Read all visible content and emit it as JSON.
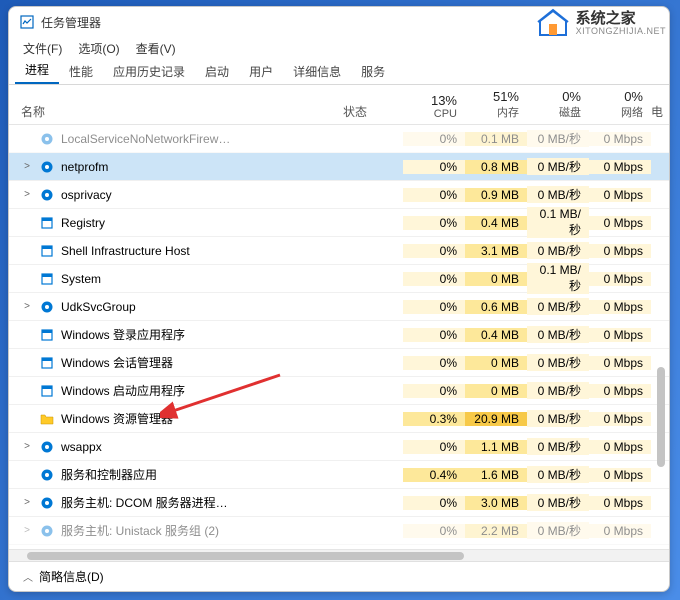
{
  "window": {
    "title": "任务管理器"
  },
  "menu": {
    "file": "文件(F)",
    "options": "选项(O)",
    "view": "查看(V)"
  },
  "tabs": [
    "进程",
    "性能",
    "应用历史记录",
    "启动",
    "用户",
    "详细信息",
    "服务"
  ],
  "activeTab": 0,
  "headers": {
    "name": "名称",
    "status": "状态",
    "cpu_pct": "13%",
    "cpu_lbl": "CPU",
    "mem_pct": "51%",
    "mem_lbl": "内存",
    "disk_pct": "0%",
    "disk_lbl": "磁盘",
    "net_pct": "0%",
    "net_lbl": "网络",
    "power": "电"
  },
  "rows": [
    {
      "icon": "gear",
      "name": "LocalServiceNoNetworkFirew…",
      "cpu": "0%",
      "mem": "0.1 MB",
      "disk": "0 MB/秒",
      "net": "0 Mbps",
      "expand": "",
      "faded": true
    },
    {
      "icon": "gear",
      "name": "netprofm",
      "cpu": "0%",
      "mem": "0.8 MB",
      "disk": "0 MB/秒",
      "net": "0 Mbps",
      "expand": ">",
      "selected": true
    },
    {
      "icon": "gear",
      "name": "osprivacy",
      "cpu": "0%",
      "mem": "0.9 MB",
      "disk": "0 MB/秒",
      "net": "0 Mbps",
      "expand": ">"
    },
    {
      "icon": "app",
      "name": "Registry",
      "cpu": "0%",
      "mem": "0.4 MB",
      "disk": "0.1 MB/秒",
      "net": "0 Mbps",
      "expand": ""
    },
    {
      "icon": "app",
      "name": "Shell Infrastructure Host",
      "cpu": "0%",
      "mem": "3.1 MB",
      "disk": "0 MB/秒",
      "net": "0 Mbps",
      "expand": ""
    },
    {
      "icon": "app",
      "name": "System",
      "cpu": "0%",
      "mem": "0 MB",
      "disk": "0.1 MB/秒",
      "net": "0 Mbps",
      "expand": ""
    },
    {
      "icon": "gear",
      "name": "UdkSvcGroup",
      "cpu": "0%",
      "mem": "0.6 MB",
      "disk": "0 MB/秒",
      "net": "0 Mbps",
      "expand": ">"
    },
    {
      "icon": "app",
      "name": "Windows 登录应用程序",
      "cpu": "0%",
      "mem": "0.4 MB",
      "disk": "0 MB/秒",
      "net": "0 Mbps",
      "expand": ""
    },
    {
      "icon": "app",
      "name": "Windows 会话管理器",
      "cpu": "0%",
      "mem": "0 MB",
      "disk": "0 MB/秒",
      "net": "0 Mbps",
      "expand": ""
    },
    {
      "icon": "app",
      "name": "Windows 启动应用程序",
      "cpu": "0%",
      "mem": "0 MB",
      "disk": "0 MB/秒",
      "net": "0 Mbps",
      "expand": ""
    },
    {
      "icon": "folder",
      "name": "Windows 资源管理器",
      "cpu": "0.3%",
      "mem": "20.9 MB",
      "disk": "0 MB/秒",
      "net": "0 Mbps",
      "expand": "",
      "cpuHigh": true,
      "memHigh": true
    },
    {
      "icon": "gear",
      "name": "wsappx",
      "cpu": "0%",
      "mem": "1.1 MB",
      "disk": "0 MB/秒",
      "net": "0 Mbps",
      "expand": ">"
    },
    {
      "icon": "gear",
      "name": "服务和控制器应用",
      "cpu": "0.4%",
      "mem": "1.6 MB",
      "disk": "0 MB/秒",
      "net": "0 Mbps",
      "expand": "",
      "cpuHigh": true
    },
    {
      "icon": "gear",
      "name": "服务主机: DCOM 服务器进程…",
      "cpu": "0%",
      "mem": "3.0 MB",
      "disk": "0 MB/秒",
      "net": "0 Mbps",
      "expand": ">"
    },
    {
      "icon": "gear",
      "name": "服务主机: Unistack 服务组 (2)",
      "cpu": "0%",
      "mem": "2.2 MB",
      "disk": "0 MB/秒",
      "net": "0 Mbps",
      "expand": ">",
      "faded": true
    }
  ],
  "bottom": {
    "label": "简略信息(D)"
  },
  "watermark": {
    "text": "系统之家",
    "sub": "XITONGZHIJIA.NET"
  }
}
